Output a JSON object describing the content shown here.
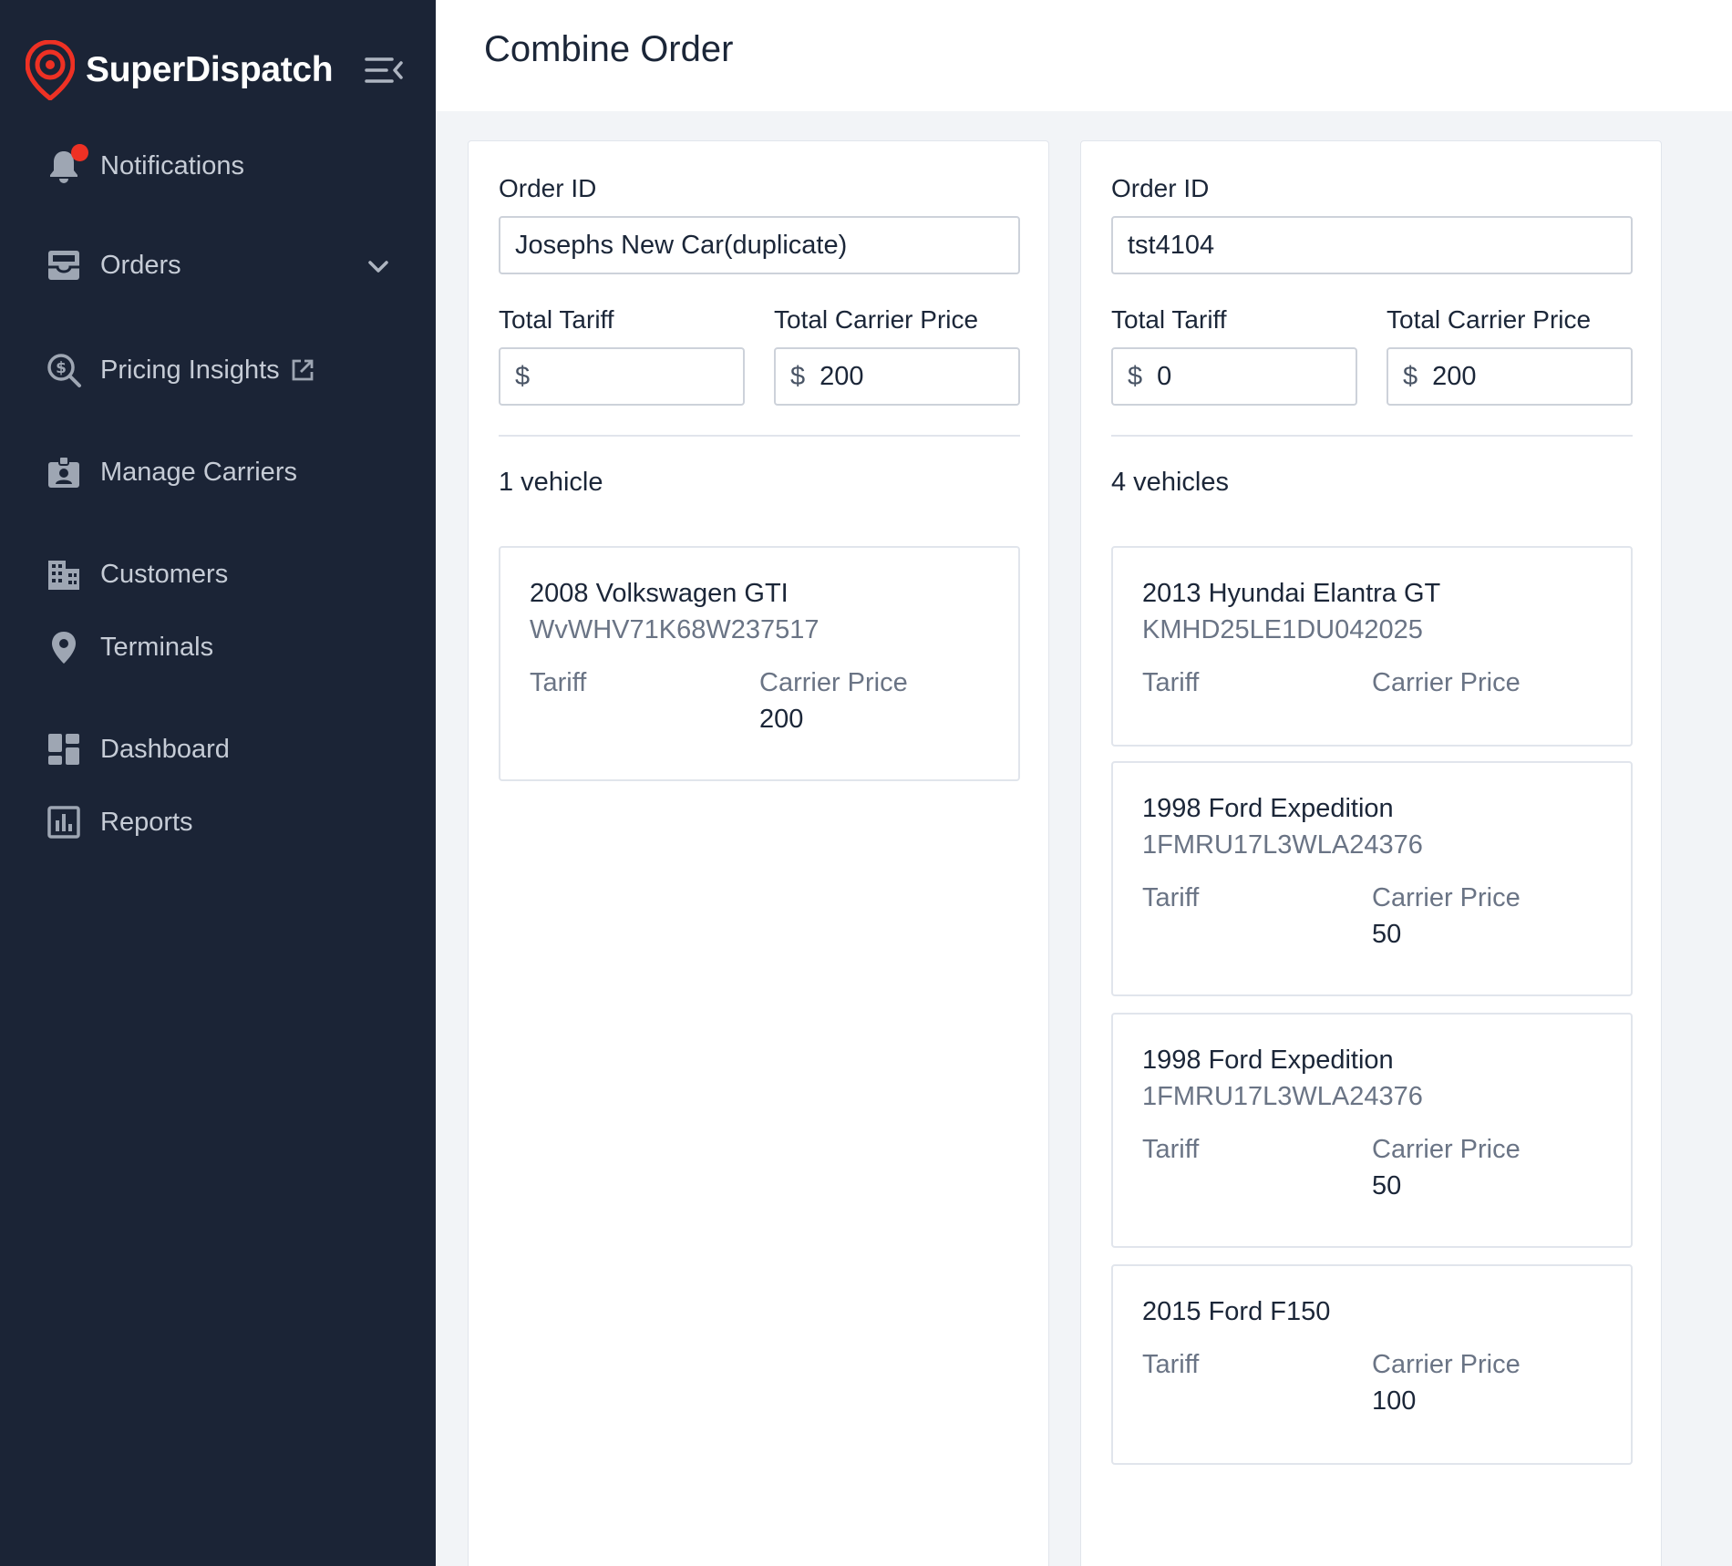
{
  "app": {
    "name": "SuperDispatch"
  },
  "colors": {
    "sidebar_bg": "#1b2436",
    "brand_red": "#ee3124",
    "page_bg": "#f2f4f7"
  },
  "sidebar": {
    "items": [
      {
        "label": "Notifications",
        "icon": "bell-icon",
        "has_badge": true
      },
      {
        "label": "Orders",
        "icon": "inbox-icon",
        "expandable": true
      },
      {
        "label": "Pricing Insights",
        "icon": "dollar-search-icon",
        "external": true
      },
      {
        "label": "Manage Carriers",
        "icon": "badge-icon"
      },
      {
        "label": "Customers",
        "icon": "building-icon"
      },
      {
        "label": "Terminals",
        "icon": "pin-icon"
      },
      {
        "label": "Dashboard",
        "icon": "dashboard-icon"
      },
      {
        "label": "Reports",
        "icon": "chart-icon"
      }
    ]
  },
  "header": {
    "title": "Combine Order"
  },
  "labels": {
    "order_id": "Order ID",
    "total_tariff": "Total Tariff",
    "total_carrier_price": "Total Carrier Price",
    "currency": "$",
    "tariff": "Tariff",
    "carrier_price": "Carrier Price"
  },
  "orders": [
    {
      "order_id": "Josephs New Car(duplicate)",
      "total_tariff": "",
      "total_carrier_price": "200",
      "vehicle_count": "1 vehicle",
      "vehicles": [
        {
          "title": "2008 Volkswagen GTI",
          "vin": "WvWHV71K68W237517",
          "tariff": "",
          "carrier_price": "200"
        }
      ]
    },
    {
      "order_id": "tst4104",
      "total_tariff": "0",
      "total_carrier_price": "200",
      "vehicle_count": "4 vehicles",
      "vehicles": [
        {
          "title": "2013 Hyundai Elantra GT",
          "vin": "KMHD25LE1DU042025",
          "tariff": "",
          "carrier_price": ""
        },
        {
          "title": "1998 Ford Expedition",
          "vin": "1FMRU17L3WLA24376",
          "tariff": "",
          "carrier_price": "50"
        },
        {
          "title": "1998 Ford Expedition",
          "vin": "1FMRU17L3WLA24376",
          "tariff": "",
          "carrier_price": "50"
        },
        {
          "title": "2015 Ford F150",
          "vin": "",
          "tariff": "",
          "carrier_price": "100"
        }
      ]
    }
  ]
}
